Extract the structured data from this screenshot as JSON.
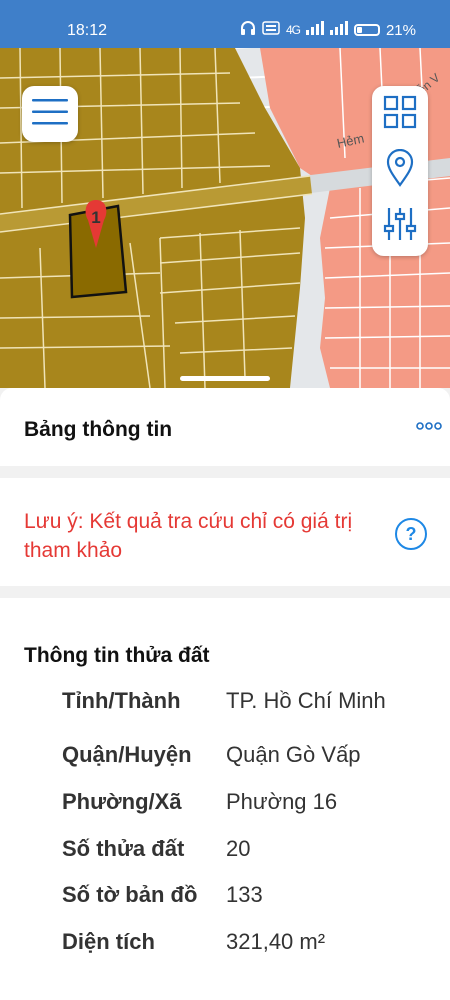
{
  "status_bar": {
    "time": "18:12",
    "network_label": "4G",
    "battery": "21%"
  },
  "map": {
    "street_label": "Hẻm",
    "street_label_2": "uyễn V",
    "parcel_marker": "1",
    "colors": {
      "land": "#a8861c",
      "parcel": "#8a6a00",
      "salmon": "#f49a85",
      "road": "#e4e7ea",
      "marker": "#e53935"
    }
  },
  "panel": {
    "title": "Bảng thông tin",
    "more_icon": "more-dots-icon"
  },
  "note": {
    "text": "Lưu ý: Kết quả tra cứu chỉ có giá trị tham khảo",
    "help_symbol": "?"
  },
  "parcel_info": {
    "title": "Thông tin thửa đất",
    "rows": [
      {
        "label": "Tỉnh/Thành",
        "value": "TP. Hồ Chí Minh"
      },
      {
        "label": "Quận/Huyện",
        "value": "Quận Gò Vấp"
      },
      {
        "label": "Phường/Xã",
        "value": "Phường 16"
      },
      {
        "label": "Số thửa đất",
        "value": "20"
      },
      {
        "label": "Số tờ bản đồ",
        "value": "133"
      },
      {
        "label": "Diện tích",
        "value": "321,40 m²"
      }
    ]
  }
}
